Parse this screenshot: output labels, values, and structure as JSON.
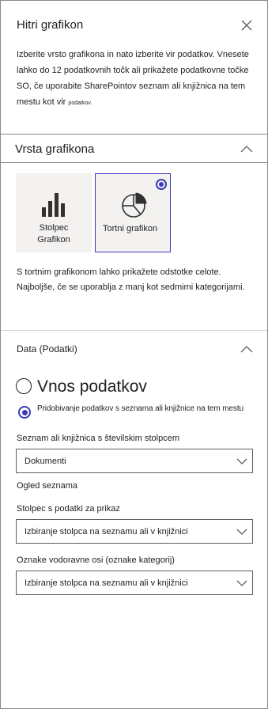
{
  "panel": {
    "title": "Hitri grafikon",
    "intro_main": "Izberite vrsto grafikona in nato izberite vir podatkov. Vnesete lahko do 12 podatkovnih točk ali prikažete podatkovne točke SO, če uporabite SharePointov seznam ali knjižnica na tem mestu kot vir",
    "intro_tail": "podatkov."
  },
  "chart_type_section": {
    "title": "Vrsta grafikona",
    "options": [
      {
        "line1": "Stolpec",
        "line2": "Grafikon",
        "icon": "bar-chart-icon",
        "selected": false
      },
      {
        "line1": "Tortni grafikon",
        "icon": "pie-chart-icon",
        "selected": true
      }
    ],
    "description": "S tortnim grafikonom lahko prikažete odstotke celote. Najboljše, če se uporablja z manj kot sedmimi kategorijami."
  },
  "data_section": {
    "title": "Data (Podatki)",
    "source_options": [
      {
        "label": "Vnos podatkov",
        "selected": false
      },
      {
        "label": "Pridobivanje podatkov s seznama ali knjižnice na tem mestu",
        "selected": true
      }
    ],
    "list_label": "Seznam ali knjižnica s številskim stolpcem",
    "list_value": "Dokumenti",
    "list_view_label": "Ogled seznama",
    "data_column_label": "Stolpec s podatki za prikaz",
    "data_column_value": "Izbiranje stolpca na seznamu ali v knjižnici",
    "axis_label": "Oznake vodoravne osi (oznake kategorij)",
    "axis_value": "Izbiranje stolpca na seznamu ali v knjižnici"
  },
  "colors": {
    "accent": "#3b3ab8",
    "border": "#8a8886",
    "tile_bg": "#f3f2f1"
  }
}
